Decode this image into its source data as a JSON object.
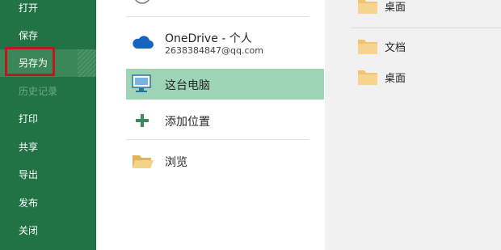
{
  "sidebar": {
    "items": [
      {
        "label": "打开",
        "state": "normal"
      },
      {
        "label": "保存",
        "state": "normal"
      },
      {
        "label": "另存为",
        "state": "selected"
      },
      {
        "label": "历史记录",
        "state": "disabled"
      },
      {
        "label": "打印",
        "state": "normal"
      },
      {
        "label": "共享",
        "state": "normal"
      },
      {
        "label": "导出",
        "state": "normal"
      },
      {
        "label": "发布",
        "state": "normal"
      },
      {
        "label": "关闭",
        "state": "normal"
      }
    ]
  },
  "locations": {
    "onedrive": {
      "label": "OneDrive - 个人",
      "account": "2638384847@qq.com",
      "icon": "cloud-icon"
    },
    "this_pc": {
      "label": "这台电脑",
      "icon": "computer-icon",
      "selected": true
    },
    "add_place": {
      "label": "添加位置",
      "icon": "plus-icon"
    },
    "browse": {
      "label": "浏览",
      "icon": "folder-open-icon"
    }
  },
  "folders": {
    "top": {
      "label": "桌面",
      "icon": "folder-icon"
    },
    "items": [
      {
        "label": "文档",
        "icon": "folder-icon"
      },
      {
        "label": "桌面",
        "icon": "folder-icon"
      }
    ]
  },
  "colors": {
    "sidebar_bg": "#217346",
    "selected_location": "#9fd5b7",
    "highlight_border": "#c0161f"
  }
}
